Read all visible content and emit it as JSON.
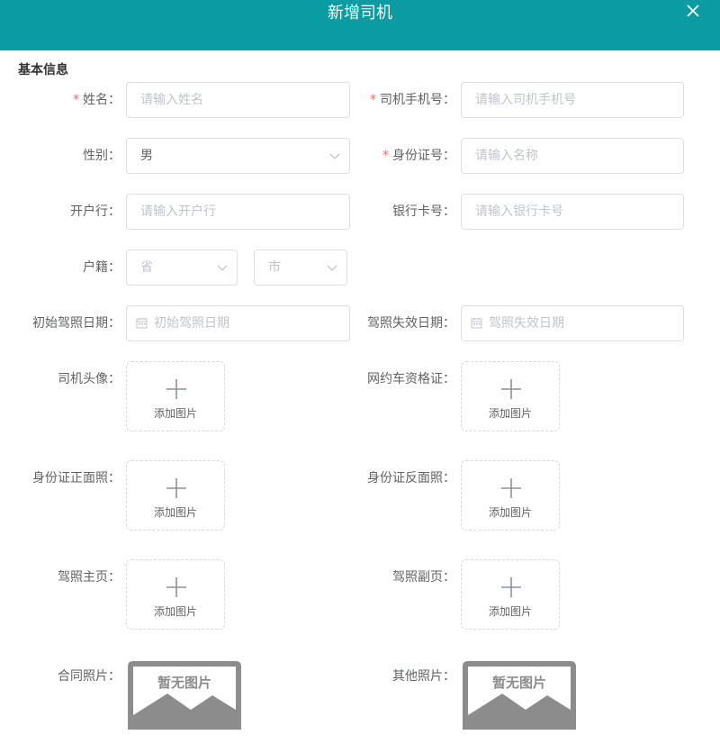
{
  "dialog": {
    "title": "新增司机"
  },
  "section": {
    "title": "基本信息"
  },
  "fields": {
    "name": {
      "label": "姓名：",
      "required_mark": "*",
      "placeholder": "请输入姓名"
    },
    "phone": {
      "label": "司机手机号：",
      "required_mark": "*",
      "placeholder": "请输入司机手机号"
    },
    "gender": {
      "label": "性别：",
      "value": "男"
    },
    "id_number": {
      "label": "身份证号：",
      "required_mark": "*",
      "placeholder": "请输入名称"
    },
    "bank": {
      "label": "开户行：",
      "placeholder": "请输入开户行"
    },
    "bank_card": {
      "label": "银行卡号：",
      "placeholder": "请输入银行卡号"
    },
    "household": {
      "label": "户籍：",
      "province_placeholder": "省",
      "city_placeholder": "市"
    },
    "license_start": {
      "label": "初始驾照日期：",
      "placeholder": "初始驾照日期"
    },
    "license_expire": {
      "label": "驾照失效日期：",
      "placeholder": "驾照失效日期"
    }
  },
  "uploads": {
    "add_label": "添加图片",
    "avatar": {
      "label": "司机头像："
    },
    "ride_hailing_cert": {
      "label": "网约车资格证："
    },
    "id_front": {
      "label": "身份证正面照："
    },
    "id_back": {
      "label": "身份证反面照："
    },
    "license_main": {
      "label": "驾照主页："
    },
    "license_sub": {
      "label": "驾照副页："
    }
  },
  "photos": {
    "no_image_text": "暂无图片",
    "contract": {
      "label": "合同照片："
    },
    "other": {
      "label": "其他照片："
    }
  },
  "colors": {
    "header_bg": "#0a9ba3",
    "required": "#f56c6c",
    "border": "#dcdfe6",
    "placeholder": "#c0c4cc"
  }
}
